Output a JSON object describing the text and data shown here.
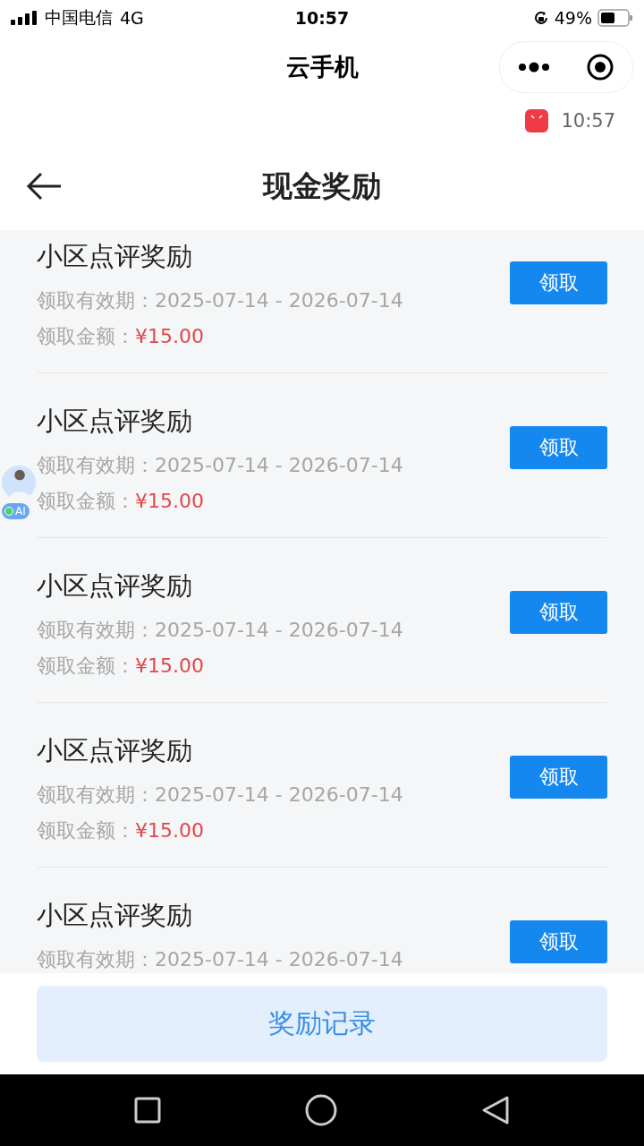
{
  "status_bar": {
    "carrier": "中国电信",
    "network": "4G",
    "time": "10:57",
    "battery": "49%"
  },
  "mini_program_bar": {
    "title": "云手机"
  },
  "notification": {
    "time": "10:57"
  },
  "header": {
    "title": "现金奖励"
  },
  "rewards": [
    {
      "title": "小区点评奖励",
      "validity_label": "领取有效期：",
      "validity": "2025-07-14 - 2026-07-14",
      "amount_label": "领取金额：",
      "amount": "¥15.00",
      "button": "领取"
    },
    {
      "title": "小区点评奖励",
      "validity_label": "领取有效期：",
      "validity": "2025-07-14 - 2026-07-14",
      "amount_label": "领取金额：",
      "amount": "¥15.00",
      "button": "领取"
    },
    {
      "title": "小区点评奖励",
      "validity_label": "领取有效期：",
      "validity": "2025-07-14 - 2026-07-14",
      "amount_label": "领取金额：",
      "amount": "¥15.00",
      "button": "领取"
    },
    {
      "title": "小区点评奖励",
      "validity_label": "领取有效期：",
      "validity": "2025-07-14 - 2026-07-14",
      "amount_label": "领取金额：",
      "amount": "¥15.00",
      "button": "领取"
    },
    {
      "title": "小区点评奖励",
      "validity_label": "领取有效期：",
      "validity": "2025-07-14 - 2026-07-14",
      "button": "领取"
    }
  ],
  "assistant": {
    "badge": "AI"
  },
  "footer": {
    "button": "奖励记录"
  }
}
